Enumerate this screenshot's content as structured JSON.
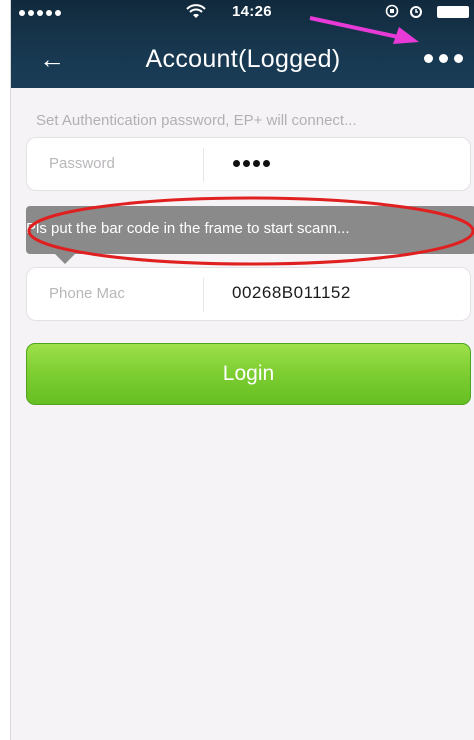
{
  "status_bar": {
    "time": "14:26",
    "signal_icon": "signal-dots-icon",
    "wifi_icon": "wifi-icon",
    "battery_icon": "battery-icon"
  },
  "nav": {
    "back_icon": "arrow-left-icon",
    "back_glyph": "←",
    "title": "Account(Logged)",
    "more_icon": "more-dots-icon"
  },
  "form": {
    "hint": "Set Authentication password, EP+ will connect...",
    "password": {
      "label": "Password",
      "value_masked": "••••"
    },
    "phone_mac": {
      "label": "Phone Mac",
      "value": "00268B011152"
    }
  },
  "toast": {
    "text": "Pls put the bar code in the frame to start scann..."
  },
  "login_button": {
    "label": "Login"
  },
  "colors": {
    "nav_bg": "#17374f",
    "login_green": "#7fcf33",
    "annotation_red": "#e02020",
    "annotation_magenta": "#e83ad6"
  }
}
